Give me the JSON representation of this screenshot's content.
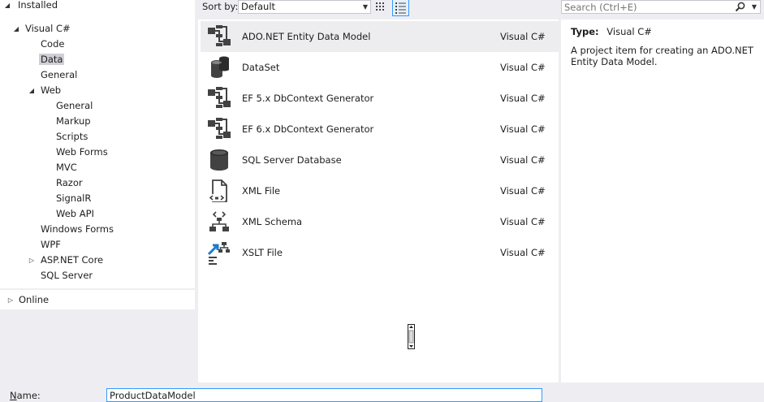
{
  "tree": {
    "installed": "Installed",
    "visual_csharp": "Visual C#",
    "code": "Code",
    "data": "Data",
    "general": "General",
    "web": "Web",
    "web_general": "General",
    "markup": "Markup",
    "scripts": "Scripts",
    "web_forms": "Web Forms",
    "mvc": "MVC",
    "razor": "Razor",
    "signalr": "SignalR",
    "web_api": "Web API",
    "windows_forms": "Windows Forms",
    "wpf": "WPF",
    "aspnet_core": "ASP.NET Core",
    "sql_server": "SQL Server",
    "online": "Online"
  },
  "toolbar": {
    "sort_label": "Sort by:",
    "sort_value": "Default"
  },
  "search": {
    "placeholder": "Search (Ctrl+E)"
  },
  "templates": [
    {
      "name": "ADO.NET Entity Data Model",
      "lang": "Visual C#",
      "icon": "entity-model-icon"
    },
    {
      "name": "DataSet",
      "lang": "Visual C#",
      "icon": "dataset-icon"
    },
    {
      "name": "EF 5.x DbContext Generator",
      "lang": "Visual C#",
      "icon": "entity-model-icon"
    },
    {
      "name": "EF 6.x DbContext Generator",
      "lang": "Visual C#",
      "icon": "entity-model-icon"
    },
    {
      "name": "SQL Server Database",
      "lang": "Visual C#",
      "icon": "database-icon"
    },
    {
      "name": "XML File",
      "lang": "Visual C#",
      "icon": "xml-file-icon"
    },
    {
      "name": "XML Schema",
      "lang": "Visual C#",
      "icon": "xml-schema-icon"
    },
    {
      "name": "XSLT File",
      "lang": "Visual C#",
      "icon": "xslt-file-icon"
    }
  ],
  "details": {
    "type_label": "Type:",
    "type_value": "Visual C#",
    "description": "A project item for creating an ADO.NET Entity Data Model."
  },
  "name_field": {
    "label": "Name:",
    "value": "ProductDataModel"
  },
  "colors": {
    "background": "#eeeef2",
    "panel": "#ffffff",
    "selected_row": "#ededf0",
    "selected_tree": "#cfcfd6",
    "focus_border": "#3399ff"
  }
}
